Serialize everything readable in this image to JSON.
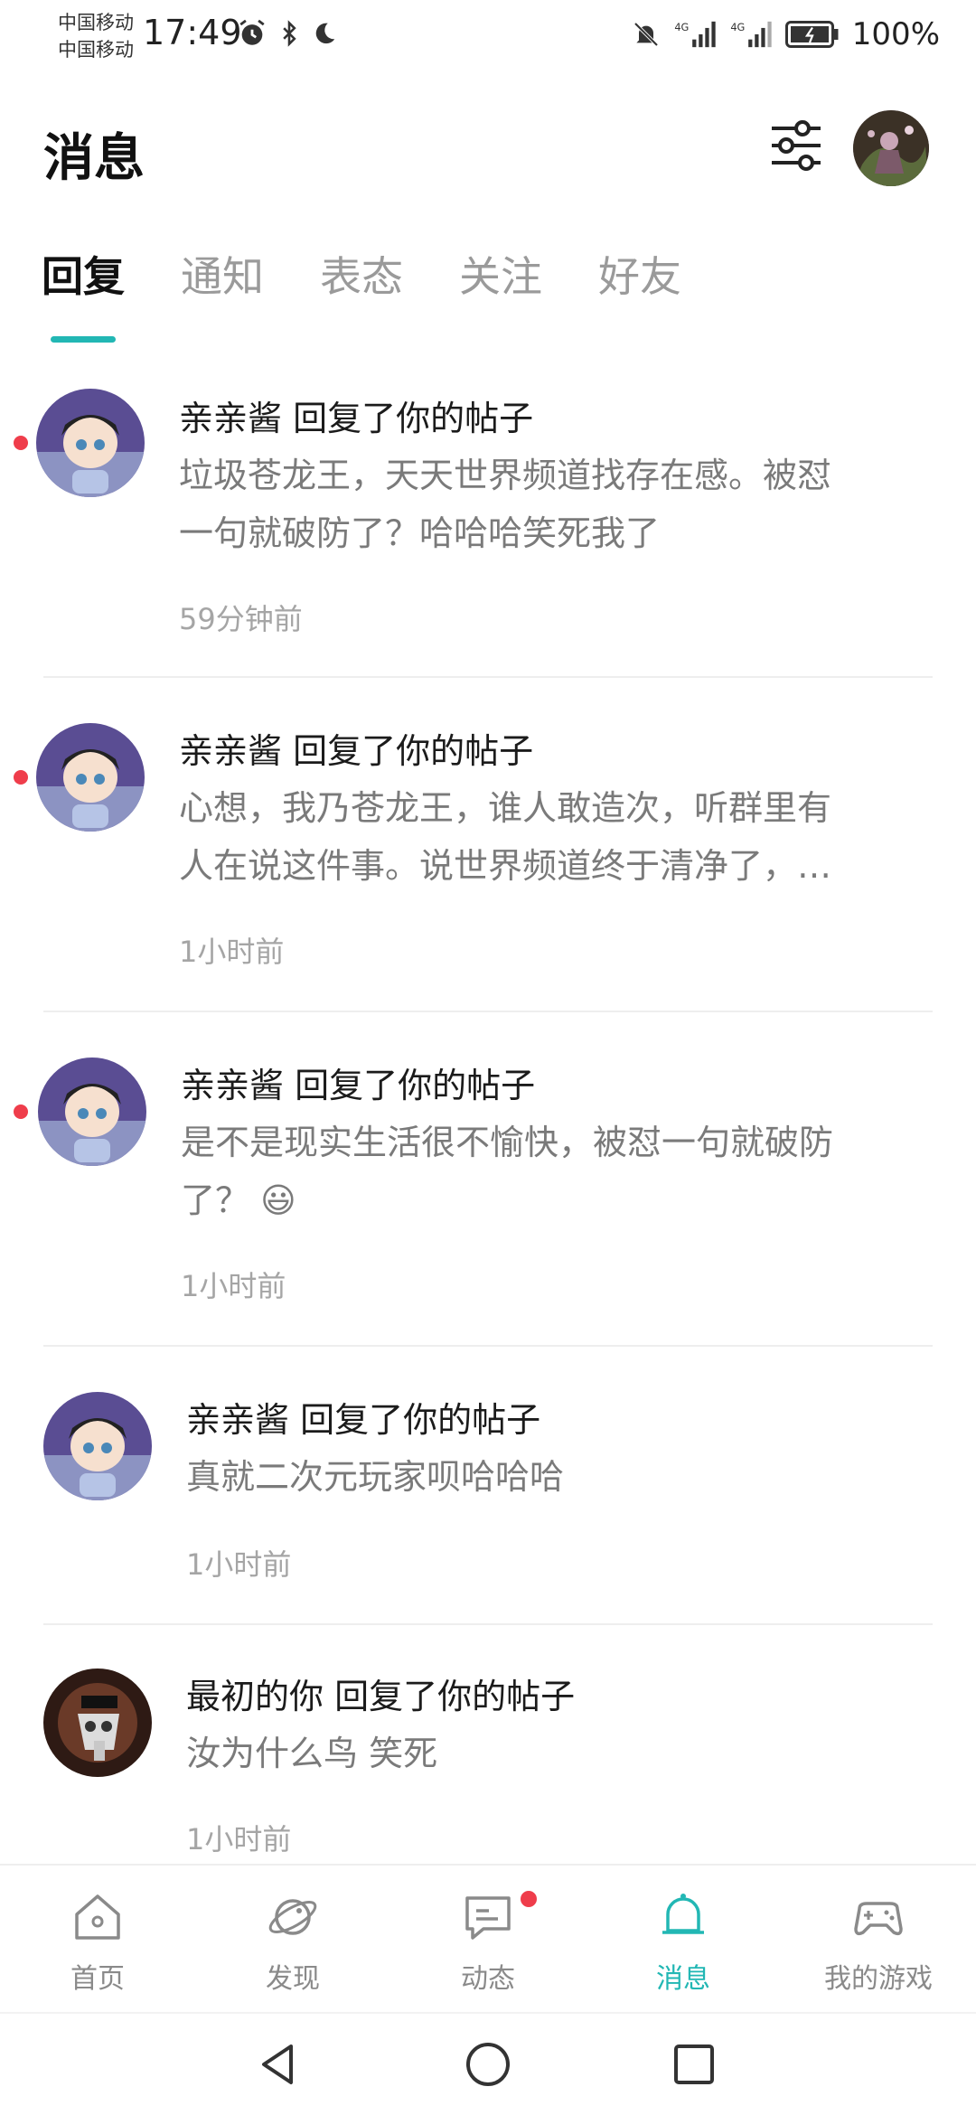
{
  "status_bar": {
    "carrier_1": "中国移动",
    "carrier_2": "中国移动",
    "time": "17:49",
    "network_1": "4G",
    "network_2": "4G",
    "battery": "100%",
    "icons": [
      "alarm-icon",
      "bluetooth-icon",
      "moon-icon",
      "bell-off-icon",
      "signal-icon",
      "battery-icon"
    ]
  },
  "header": {
    "title": "消息",
    "filter_icon": "sliders-icon"
  },
  "tabs": [
    {
      "label": "回复",
      "active": true
    },
    {
      "label": "通知",
      "active": false
    },
    {
      "label": "表态",
      "active": false
    },
    {
      "label": "关注",
      "active": false
    },
    {
      "label": "好友",
      "active": false
    }
  ],
  "accent_color": "#22b7b4",
  "unread_color": "#ef3d4b",
  "messages": [
    {
      "title": "亲亲酱 回复了你的帖子",
      "body_1": "垃圾苍龙王，天天世界频道找存在感。被怼",
      "body_2": "一句就破防了？哈哈哈笑死我了",
      "time": "59分钟前",
      "unread": true
    },
    {
      "title": "亲亲酱 回复了你的帖子",
      "body_1": "心想，我乃苍龙王，谁人敢造次，听群里有",
      "body_2": "人在说这件事。说世界频道终于清净了，…",
      "time": "1小时前",
      "unread": true
    },
    {
      "title": "亲亲酱 回复了你的帖子",
      "body_1": "是不是现实生活很不愉快，被怼一句就破防",
      "body_2": "了？ 😃",
      "time": "1小时前",
      "unread": true
    },
    {
      "title": "亲亲酱 回复了你的帖子",
      "body_1": "真就二次元玩家呗哈哈哈",
      "time": "1小时前",
      "unread": false
    },
    {
      "title": "最初的你 回复了你的帖子",
      "body_1": "汝为什么鸟 笑死",
      "time": "1小时前",
      "unread": false
    }
  ],
  "bottom_nav": [
    {
      "label": "首页",
      "icon": "home-icon",
      "active": false
    },
    {
      "label": "发现",
      "icon": "planet-icon",
      "active": false
    },
    {
      "label": "动态",
      "icon": "chat-icon",
      "active": false,
      "badge": true
    },
    {
      "label": "消息",
      "icon": "bell-icon",
      "active": true
    },
    {
      "label": "我的游戏",
      "icon": "gamepad-icon",
      "active": false
    }
  ]
}
